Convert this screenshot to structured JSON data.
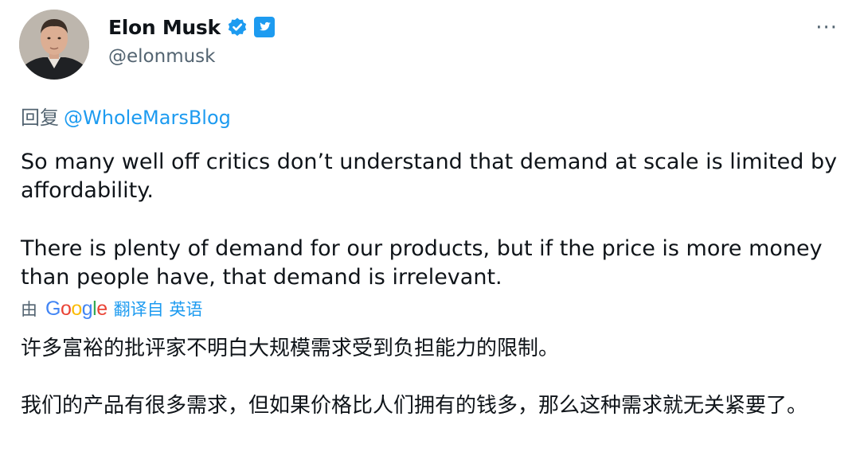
{
  "author": {
    "display_name": "Elon Musk",
    "handle": "@elonmusk",
    "avatar_icon": "profile-photo",
    "verified_icon": "verified-badge-icon",
    "brand_icon": "twitter-logo-icon"
  },
  "menu": {
    "more_label": "···"
  },
  "reply": {
    "prefix": "回复",
    "mention": "@WholeMarsBlog"
  },
  "tweet": {
    "paragraph_1": "So many well off critics don’t understand that demand at scale is limited by affordability.",
    "paragraph_2": "There is plenty of demand for our products, but if the price is more money than people have, that demand is irrelevant."
  },
  "translation": {
    "by_label": "由",
    "provider": "Google",
    "link_text": "翻译自 英语",
    "paragraph_1": "许多富裕的批评家不明白大规模需求受到负担能力的限制。",
    "paragraph_2": "我们的产品有很多需求，但如果价格比人们拥有的钱多，那么这种需求就无关紧要了。"
  },
  "colors": {
    "text_primary": "#0f1419",
    "text_secondary": "#536471",
    "link": "#1d9bf0",
    "google_blue": "#4285f4",
    "google_red": "#ea4335",
    "google_yellow": "#fbbc05",
    "google_green": "#34a853"
  }
}
